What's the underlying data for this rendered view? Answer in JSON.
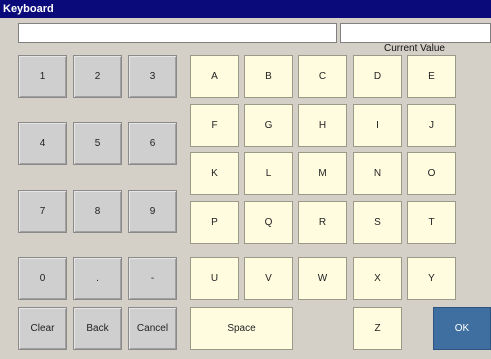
{
  "window": {
    "title": "Keyboard"
  },
  "fields": {
    "input_value": "",
    "current_value": "",
    "current_value_label": "Current Value"
  },
  "keys": {
    "n1": "1",
    "n2": "2",
    "n3": "3",
    "n4": "4",
    "n5": "5",
    "n6": "6",
    "n7": "7",
    "n8": "8",
    "n9": "9",
    "n0": "0",
    "dot": ".",
    "minus": "-",
    "clear": "Clear",
    "back": "Back",
    "cancel": "Cancel",
    "A": "A",
    "B": "B",
    "C": "C",
    "D": "D",
    "E": "E",
    "F": "F",
    "G": "G",
    "H": "H",
    "I": "I",
    "J": "J",
    "K": "K",
    "L": "L",
    "M": "M",
    "N": "N",
    "O": "O",
    "P": "P",
    "Q": "Q",
    "R": "R",
    "S": "S",
    "T": "T",
    "U": "U",
    "V": "V",
    "W": "W",
    "X": "X",
    "Y": "Y",
    "space": "Space",
    "Z": "Z",
    "ok": "OK"
  }
}
